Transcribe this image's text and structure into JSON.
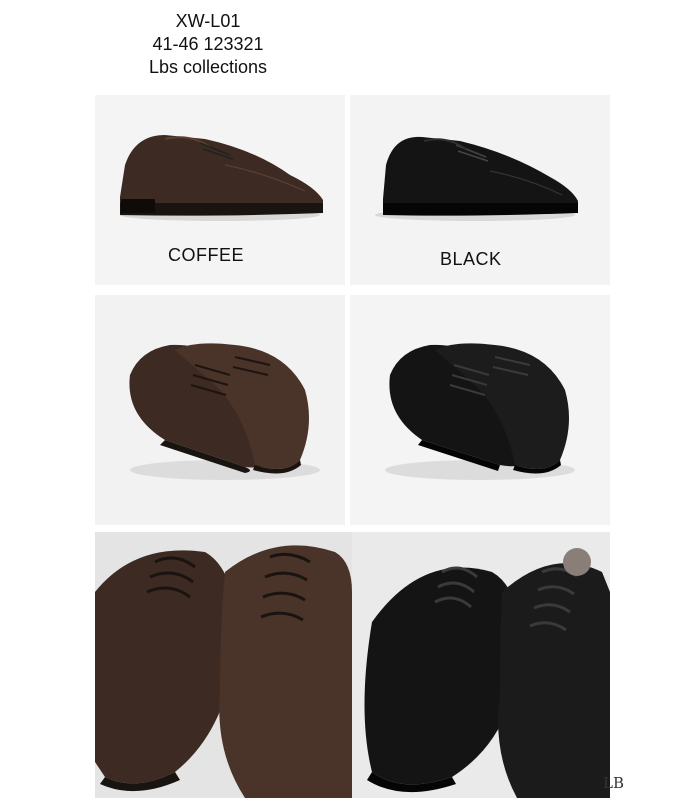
{
  "header": {
    "model": "XW-L01",
    "sizes_code": "41-46 123321",
    "brand": "Lbs collections"
  },
  "colors_labels": {
    "coffee": "COFFEE",
    "black": "BLACK"
  },
  "watermark": "LB",
  "palette": {
    "coffee": "#3d2a22",
    "black": "#141414",
    "background": "#ffffff"
  }
}
